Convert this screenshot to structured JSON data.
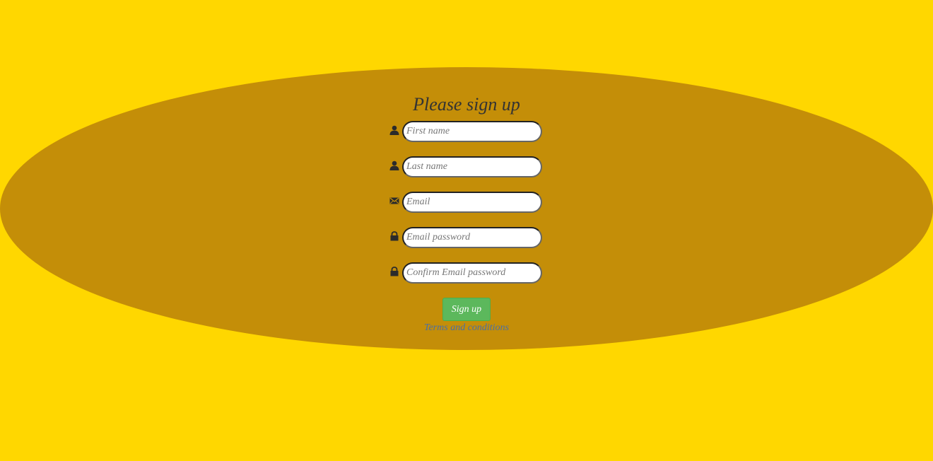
{
  "colors": {
    "background": "#FFD700",
    "ellipse": "#C48E08",
    "button": "#5CB85C",
    "link": "#4A6FA5"
  },
  "form": {
    "title": "Please sign up",
    "fields": [
      {
        "icon": "user-icon",
        "placeholder": "First name",
        "value": ""
      },
      {
        "icon": "user-icon",
        "placeholder": "Last name",
        "value": ""
      },
      {
        "icon": "envelope-icon",
        "placeholder": "Email",
        "value": ""
      },
      {
        "icon": "lock-icon",
        "placeholder": "Email password",
        "value": ""
      },
      {
        "icon": "lock-icon",
        "placeholder": "Confirm Email password",
        "value": ""
      }
    ],
    "submit_label": "Sign up",
    "terms_label": "Terms and conditions"
  }
}
